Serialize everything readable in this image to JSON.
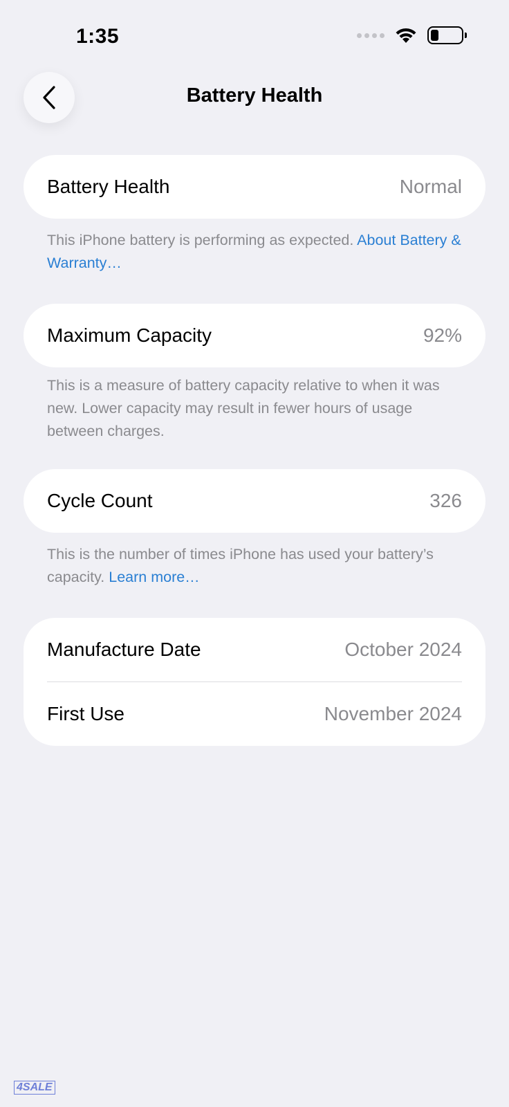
{
  "status_bar": {
    "time": "1:35",
    "icons": [
      "cellular-dots-icon",
      "wifi-icon",
      "battery-icon"
    ]
  },
  "nav": {
    "back_icon": "chevron-left-icon",
    "title": "Battery Health"
  },
  "sections": {
    "health": {
      "label": "Battery Health",
      "value": "Normal",
      "note_text": "This iPhone battery is performing as expected. ",
      "note_link": "About Battery & Warranty…"
    },
    "capacity": {
      "label": "Maximum Capacity",
      "value": "92%",
      "note_text": "This is a measure of battery capacity relative to when it was new. Lower capacity may result in fewer hours of usage between charges."
    },
    "cycles": {
      "label": "Cycle Count",
      "value": "326",
      "note_text": "This is the number of times iPhone has used your battery’s capacity. ",
      "note_link": "Learn more…"
    },
    "dates": {
      "manufacture_label": "Manufacture Date",
      "manufacture_value": "October 2024",
      "first_use_label": "First Use",
      "first_use_value": "November 2024"
    }
  },
  "watermark": "4SALE",
  "colors": {
    "background": "#f0f0f5",
    "card": "#ffffff",
    "secondary_text": "#8a8a8e",
    "link": "#2a7fd3"
  }
}
